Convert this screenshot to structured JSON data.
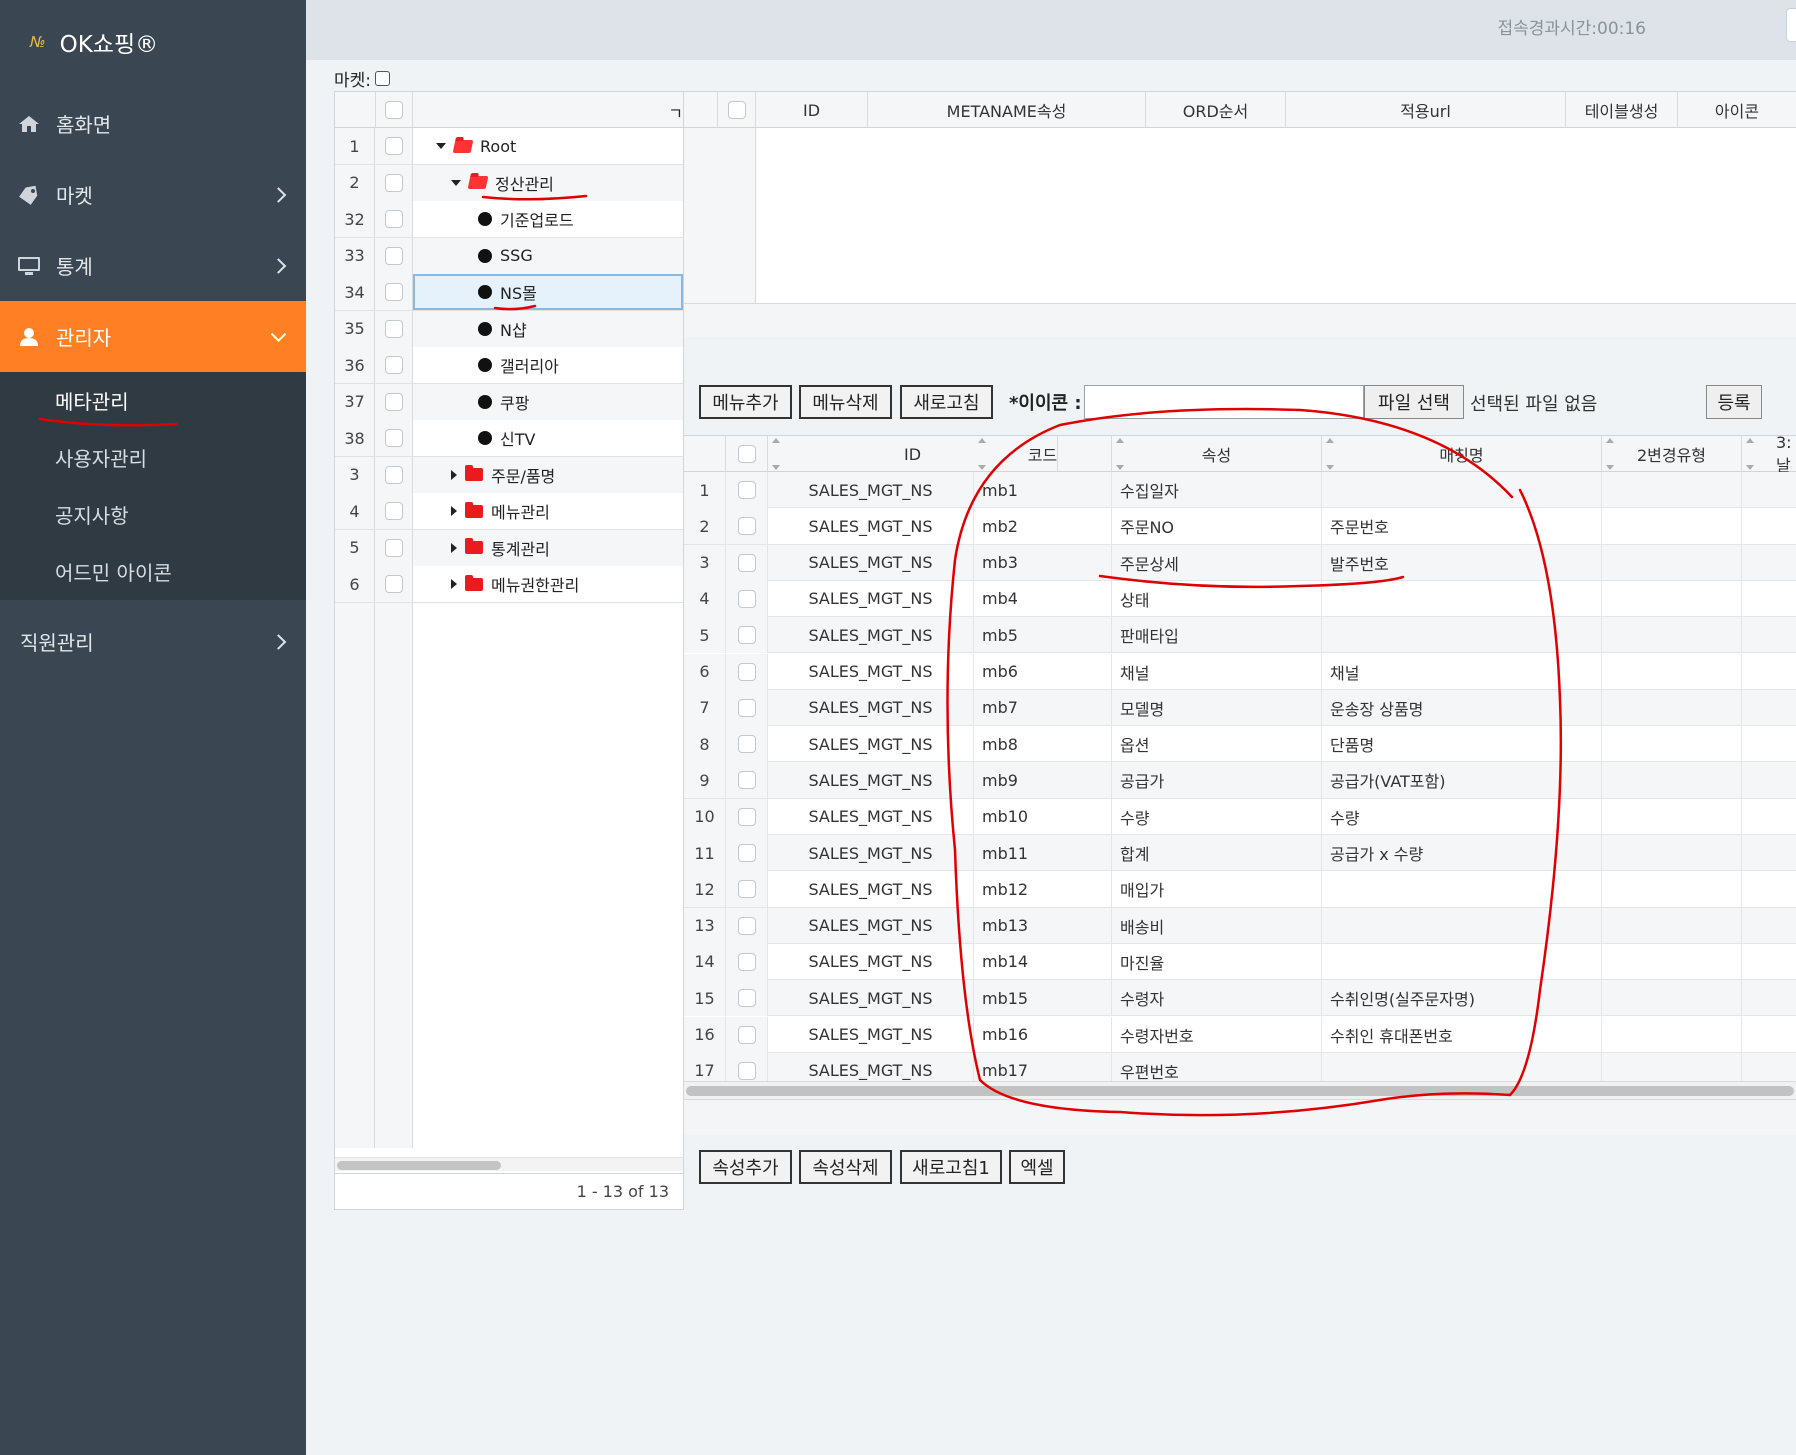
{
  "sidebar": {
    "brand": "OK쇼핑®",
    "nav": [
      {
        "label": "홈화면",
        "icon": "home-icon"
      },
      {
        "label": "마켓",
        "icon": "tag-icon"
      },
      {
        "label": "통계",
        "icon": "monitor-icon"
      },
      {
        "label": "관리자",
        "icon": "user-icon"
      }
    ],
    "admin_sub": [
      "메타관리",
      "사용자관리",
      "공지사항",
      "어드민 아이콘"
    ],
    "staff": "직원관리"
  },
  "header": {
    "elapsed": "접속경과시간:00:16"
  },
  "market_label": "마켓:",
  "tree": {
    "rows": [
      {
        "num": "1",
        "label": "Root",
        "type": "folder-open"
      },
      {
        "num": "2",
        "label": "정산관리",
        "type": "folder-open"
      },
      {
        "num": "32",
        "label": "기준업로드",
        "type": "leaf"
      },
      {
        "num": "33",
        "label": "SSG",
        "type": "leaf"
      },
      {
        "num": "34",
        "label": "NS몰",
        "type": "leaf"
      },
      {
        "num": "35",
        "label": "N샵",
        "type": "leaf"
      },
      {
        "num": "36",
        "label": "갤러리아",
        "type": "leaf"
      },
      {
        "num": "37",
        "label": "쿠팡",
        "type": "leaf"
      },
      {
        "num": "38",
        "label": "신TV",
        "type": "leaf"
      },
      {
        "num": "3",
        "label": "주문/품명",
        "type": "folder"
      },
      {
        "num": "4",
        "label": "메뉴관리",
        "type": "folder"
      },
      {
        "num": "5",
        "label": "통계관리",
        "type": "folder"
      },
      {
        "num": "6",
        "label": "메뉴권한관리",
        "type": "folder"
      }
    ],
    "header_cut": "ㄱ",
    "pager": "1 - 13 of 13"
  },
  "topgrid": {
    "columns": [
      "ID",
      "METANAME속성",
      "ORD순서",
      "적용url",
      "테이블생성",
      "아이콘"
    ]
  },
  "toolbar": {
    "add_menu": "메뉴추가",
    "delete_menu": "메뉴삭제",
    "refresh": "새로고침",
    "icon_label": "*이이콘 :",
    "file_select": "파일 선택",
    "file_none": "선택된 파일 없음",
    "register": "등록"
  },
  "maingrid": {
    "columns": [
      "ID",
      "코드",
      "속성",
      "매칭명",
      "2변경유형",
      "3:날"
    ],
    "rows": [
      {
        "num": "1",
        "id": "SALES_MGT_NS",
        "code": "mb1",
        "attr": "수집일자",
        "match": ""
      },
      {
        "num": "2",
        "id": "SALES_MGT_NS",
        "code": "mb2",
        "attr": "주문NO",
        "match": "주문번호"
      },
      {
        "num": "3",
        "id": "SALES_MGT_NS",
        "code": "mb3",
        "attr": "주문상세",
        "match": "발주번호"
      },
      {
        "num": "4",
        "id": "SALES_MGT_NS",
        "code": "mb4",
        "attr": "상태",
        "match": ""
      },
      {
        "num": "5",
        "id": "SALES_MGT_NS",
        "code": "mb5",
        "attr": "판매타입",
        "match": ""
      },
      {
        "num": "6",
        "id": "SALES_MGT_NS",
        "code": "mb6",
        "attr": "채널",
        "match": "채널"
      },
      {
        "num": "7",
        "id": "SALES_MGT_NS",
        "code": "mb7",
        "attr": "모델명",
        "match": "운송장 상품명"
      },
      {
        "num": "8",
        "id": "SALES_MGT_NS",
        "code": "mb8",
        "attr": "옵션",
        "match": "단품명"
      },
      {
        "num": "9",
        "id": "SALES_MGT_NS",
        "code": "mb9",
        "attr": "공급가",
        "match": "공급가(VAT포함)"
      },
      {
        "num": "10",
        "id": "SALES_MGT_NS",
        "code": "mb10",
        "attr": "수량",
        "match": "수량"
      },
      {
        "num": "11",
        "id": "SALES_MGT_NS",
        "code": "mb11",
        "attr": "합계",
        "match": "공급가 x 수량"
      },
      {
        "num": "12",
        "id": "SALES_MGT_NS",
        "code": "mb12",
        "attr": "매입가",
        "match": ""
      },
      {
        "num": "13",
        "id": "SALES_MGT_NS",
        "code": "mb13",
        "attr": "배송비",
        "match": ""
      },
      {
        "num": "14",
        "id": "SALES_MGT_NS",
        "code": "mb14",
        "attr": "마진율",
        "match": ""
      },
      {
        "num": "15",
        "id": "SALES_MGT_NS",
        "code": "mb15",
        "attr": "수령자",
        "match": "수취인명(실주문자명)"
      },
      {
        "num": "16",
        "id": "SALES_MGT_NS",
        "code": "mb16",
        "attr": "수령자번호",
        "match": "수취인 휴대폰번호"
      },
      {
        "num": "17",
        "id": "SALES_MGT_NS",
        "code": "mb17",
        "attr": "우편번호",
        "match": ""
      }
    ]
  },
  "bottombar": {
    "add_attr": "속성추가",
    "delete_attr": "속성삭제",
    "refresh1": "새로고침1",
    "excel": "엑셀"
  },
  "colors": {
    "sidebar": "#3a4651",
    "accent": "#ff7f24",
    "annotation": "#e00000",
    "folder": "#e81c1c"
  }
}
